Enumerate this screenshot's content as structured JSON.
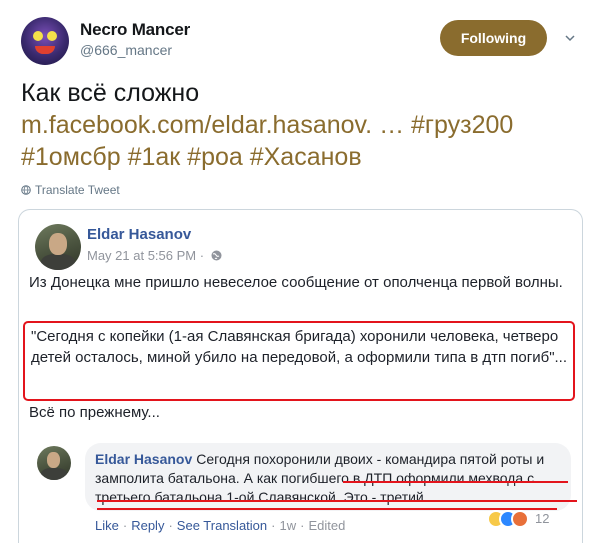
{
  "tweet": {
    "display_name": "Necro Mancer",
    "handle": "@666_mancer",
    "follow_label": "Following",
    "text_plain": "Как всё сложно",
    "text_link": "m.facebook.com/eldar.hasanov. … #груз200 #1омсбр #1ак #роа #Хасанов",
    "translate_label": "Translate Tweet",
    "accent_color": "#8a6c2e"
  },
  "fb_post": {
    "author": "Eldar Hasanov",
    "timestamp": "May 21 at 5:56 PM",
    "separator": "·",
    "intro": "Из Донецка мне пришло невеселое сообщение от ополченца первой волны.",
    "quote": "\"Сегодня с копейки (1-ая Славянская бригада) хоронили человека, четверо детей осталось, миной убило на передовой, а оформили типа в дтп погиб\"...",
    "after": "Всё по прежнему...",
    "highlight_color": "#e3141c"
  },
  "comment": {
    "author": "Eldar Hasanov",
    "text_part1": "Сегодня похоронили двоих - командира пятой роты и замполита батальона. А ",
    "text_part2": "как погибшего в ДТП оформили мехвода с третьего батальона 1-ой Славянской. Это - третий.",
    "actions": {
      "like": "Like",
      "reply": "Reply",
      "see_translation": "See Translation",
      "time": "1w",
      "edited": "Edited",
      "dot": "·"
    },
    "reaction_count": "12",
    "reaction_icons": [
      "sad-icon",
      "like-icon",
      "angry-icon"
    ]
  }
}
